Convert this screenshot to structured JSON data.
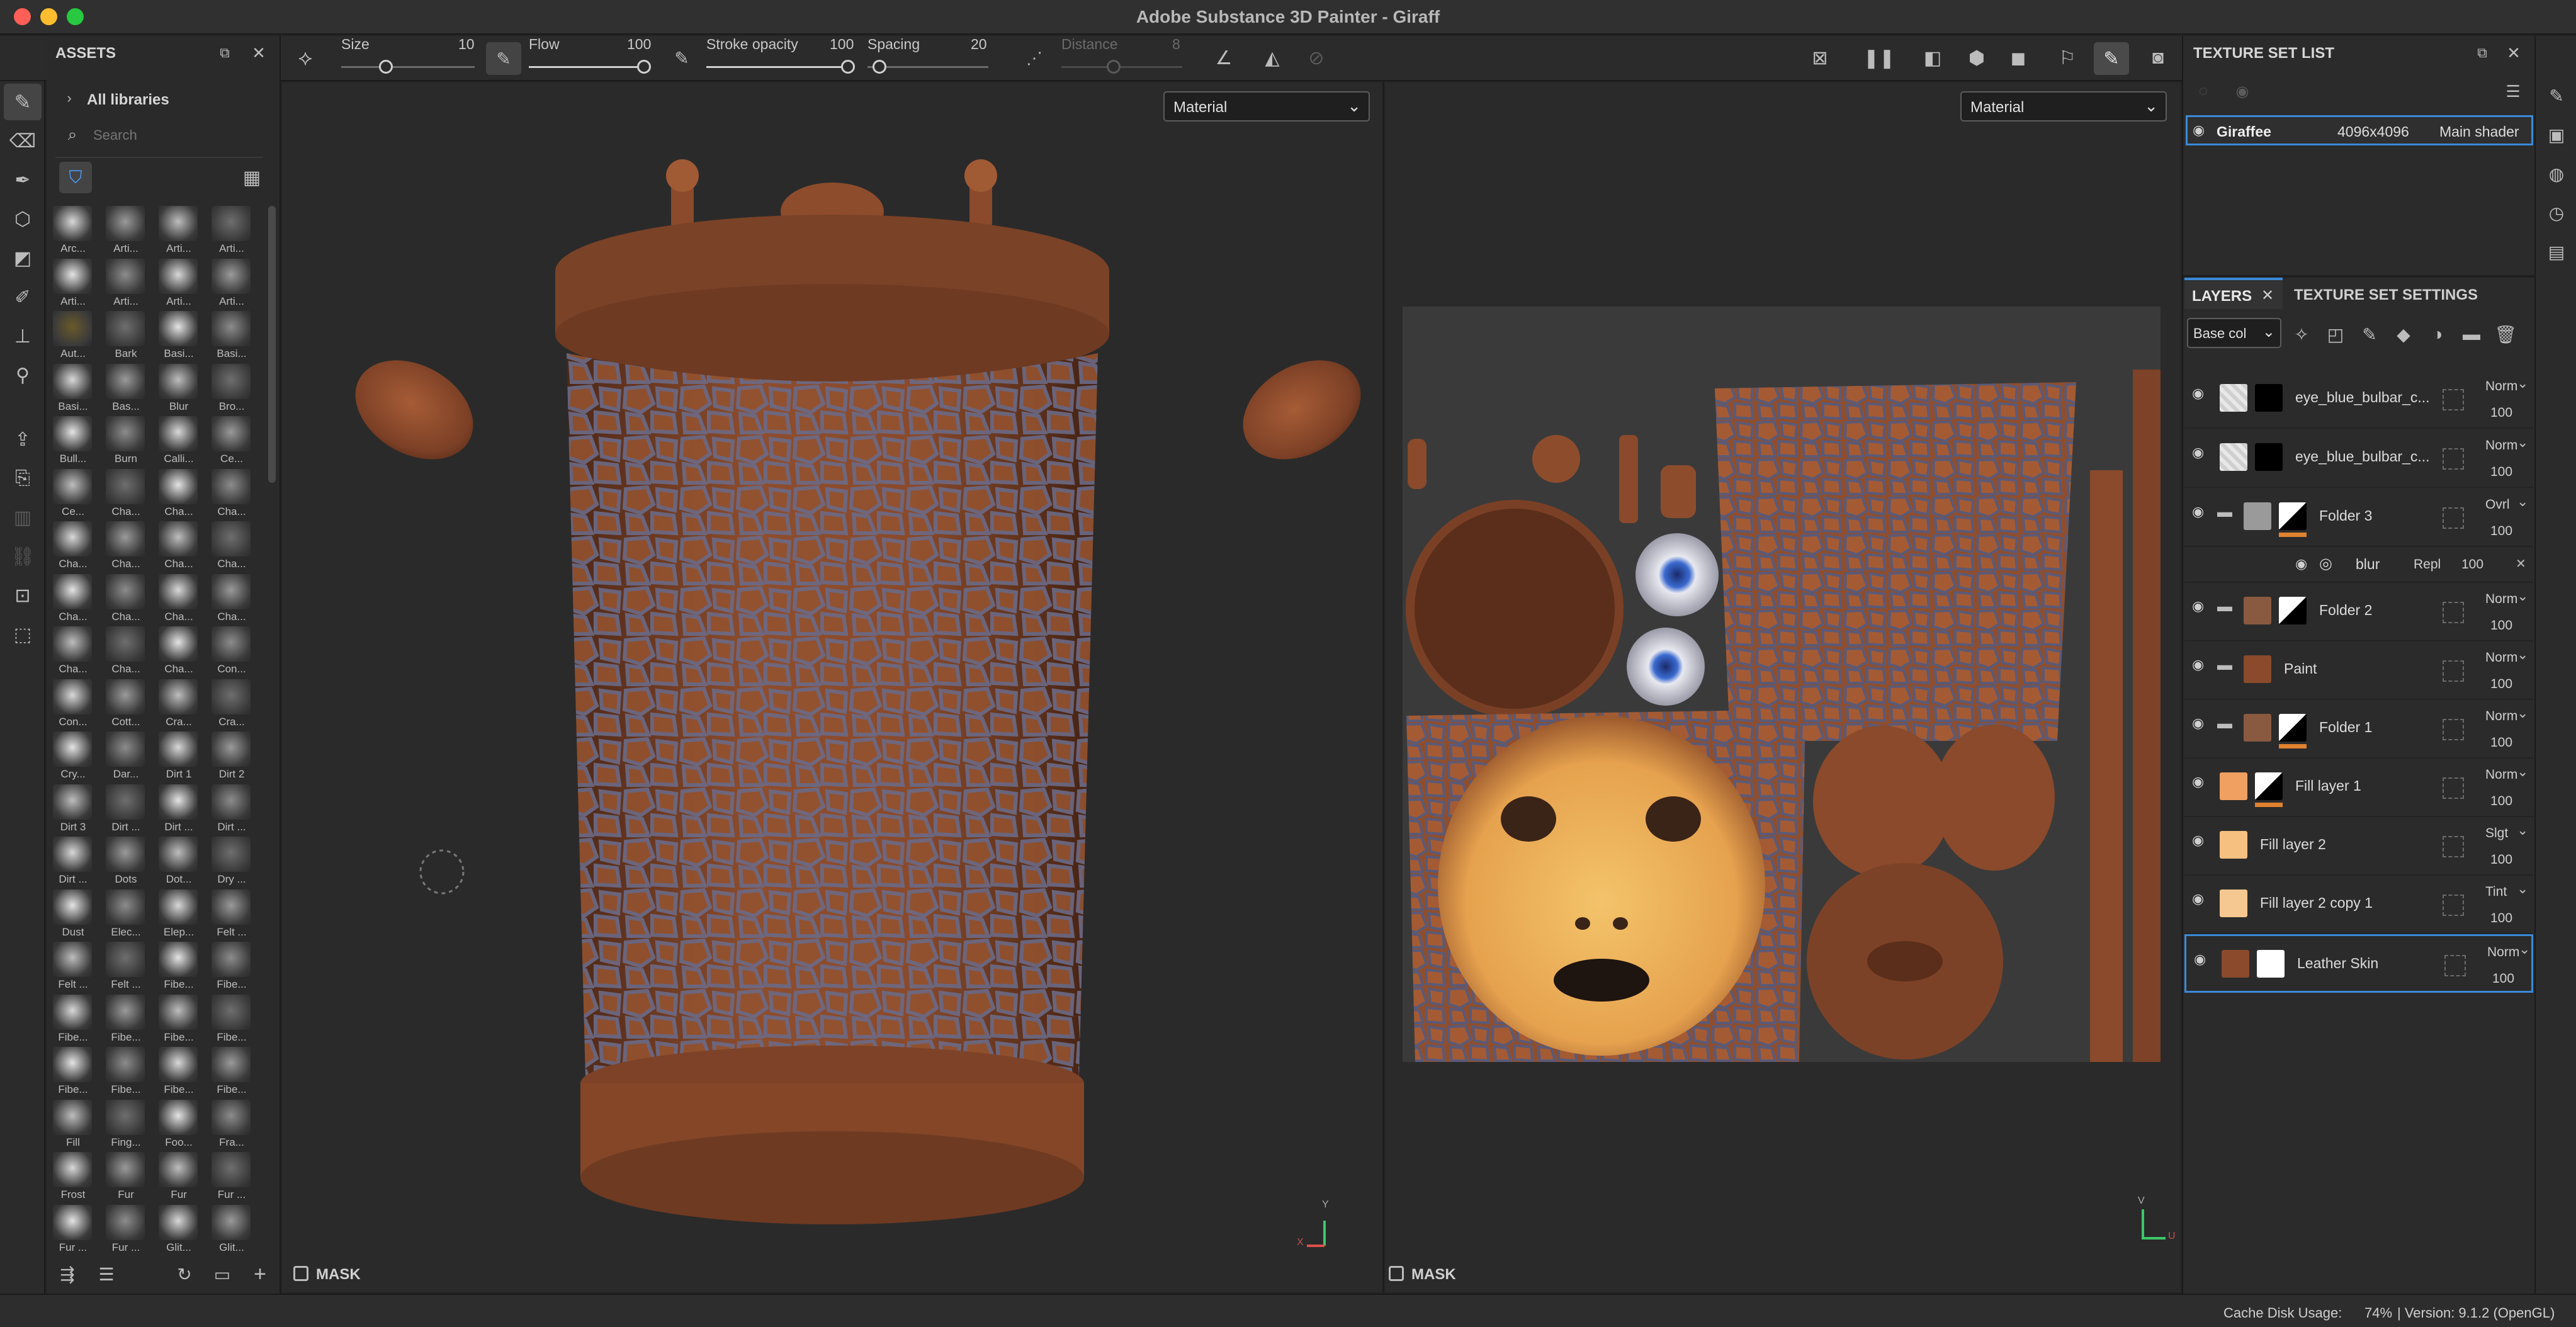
{
  "window": {
    "title": "Adobe Substance 3D Painter - Giraff"
  },
  "toolbar": {
    "size_label": "Size",
    "size_value": "10",
    "flow_label": "Flow",
    "flow_value": "100",
    "stroke_opacity_label": "Stroke opacity",
    "stroke_opacity_value": "100",
    "spacing_label": "Spacing",
    "spacing_value": "20",
    "distance_label": "Distance",
    "distance_value": "8"
  },
  "assets": {
    "title": "ASSETS",
    "breadcrumb": "All libraries",
    "search_placeholder": "Search",
    "items": [
      "Arc...",
      "Arti...",
      "Arti...",
      "Arti...",
      "Arti...",
      "Arti...",
      "Arti...",
      "Arti...",
      "Aut...",
      "Bark",
      "Basi...",
      "Basi...",
      "Basi...",
      "Bas...",
      "Blur",
      "Bro...",
      "Bull...",
      "Burn",
      "Calli...",
      "Ce...",
      "Ce...",
      "Cha...",
      "Cha...",
      "Cha...",
      "Cha...",
      "Cha...",
      "Cha...",
      "Cha...",
      "Cha...",
      "Cha...",
      "Cha...",
      "Cha...",
      "Cha...",
      "Cha...",
      "Cha...",
      "Con...",
      "Con...",
      "Cott...",
      "Cra...",
      "Cra...",
      "Cry...",
      "Dar...",
      "Dirt 1",
      "Dirt 2",
      "Dirt 3",
      "Dirt ...",
      "Dirt ...",
      "Dirt ...",
      "Dirt ...",
      "Dots",
      "Dot...",
      "Dry ...",
      "Dust",
      "Elec...",
      "Elep...",
      "Felt ...",
      "Felt ...",
      "Felt ...",
      "Fibe...",
      "Fibe...",
      "Fibe...",
      "Fibe...",
      "Fibe...",
      "Fibe...",
      "Fibe...",
      "Fibe...",
      "Fibe...",
      "Fibe...",
      "Fill",
      "Fing...",
      "Foo...",
      "Fra...",
      "Frost",
      "Fur",
      "Fur",
      "Fur ...",
      "Fur ...",
      "Fur ...",
      "Glit...",
      "Glit..."
    ]
  },
  "viewport3d": {
    "mode": "Material",
    "mask_label": "MASK",
    "axis_x": "X",
    "axis_y": "Y"
  },
  "viewport2d": {
    "mode": "Material",
    "mask_label": "MASK",
    "axis_u": "U",
    "axis_v": "V"
  },
  "texture_set_list": {
    "title": "TEXTURE SET LIST",
    "set_name": "Giraffee",
    "resolution": "4096x4096",
    "shader": "Main shader"
  },
  "layers_panel": {
    "tab_layers": "LAYERS",
    "tab_settings": "TEXTURE SET SETTINGS",
    "channel": "Base col"
  },
  "layers": [
    {
      "name": "eye_blue_bulbar_c...",
      "blend": "Norm",
      "opacity": "100"
    },
    {
      "name": "eye_blue_bulbar_c...",
      "blend": "Norm",
      "opacity": "100"
    },
    {
      "name": "Folder 3",
      "blend": "Ovrl",
      "opacity": "100"
    },
    {
      "name": "blur",
      "blend": "Repl",
      "opacity": "100"
    },
    {
      "name": "Folder 2",
      "blend": "Norm",
      "opacity": "100"
    },
    {
      "name": "Paint",
      "blend": "Norm",
      "opacity": "100"
    },
    {
      "name": "Folder 1",
      "blend": "Norm",
      "opacity": "100"
    },
    {
      "name": "Fill layer 1",
      "blend": "Norm",
      "opacity": "100"
    },
    {
      "name": "Fill layer 2",
      "blend": "Slgt",
      "opacity": "100"
    },
    {
      "name": "Fill layer 2 copy 1",
      "blend": "Tint",
      "opacity": "100"
    },
    {
      "name": "Leather Skin",
      "blend": "Norm",
      "opacity": "100"
    }
  ],
  "statusbar": {
    "cache_label": "Cache Disk Usage:",
    "cache_value": "74%",
    "version": "| Version: 9.1.2 (OpenGL)"
  },
  "colors": {
    "accent": "#3a8ad8",
    "orange": "#e0822e",
    "leather": "#8a4b2c"
  }
}
